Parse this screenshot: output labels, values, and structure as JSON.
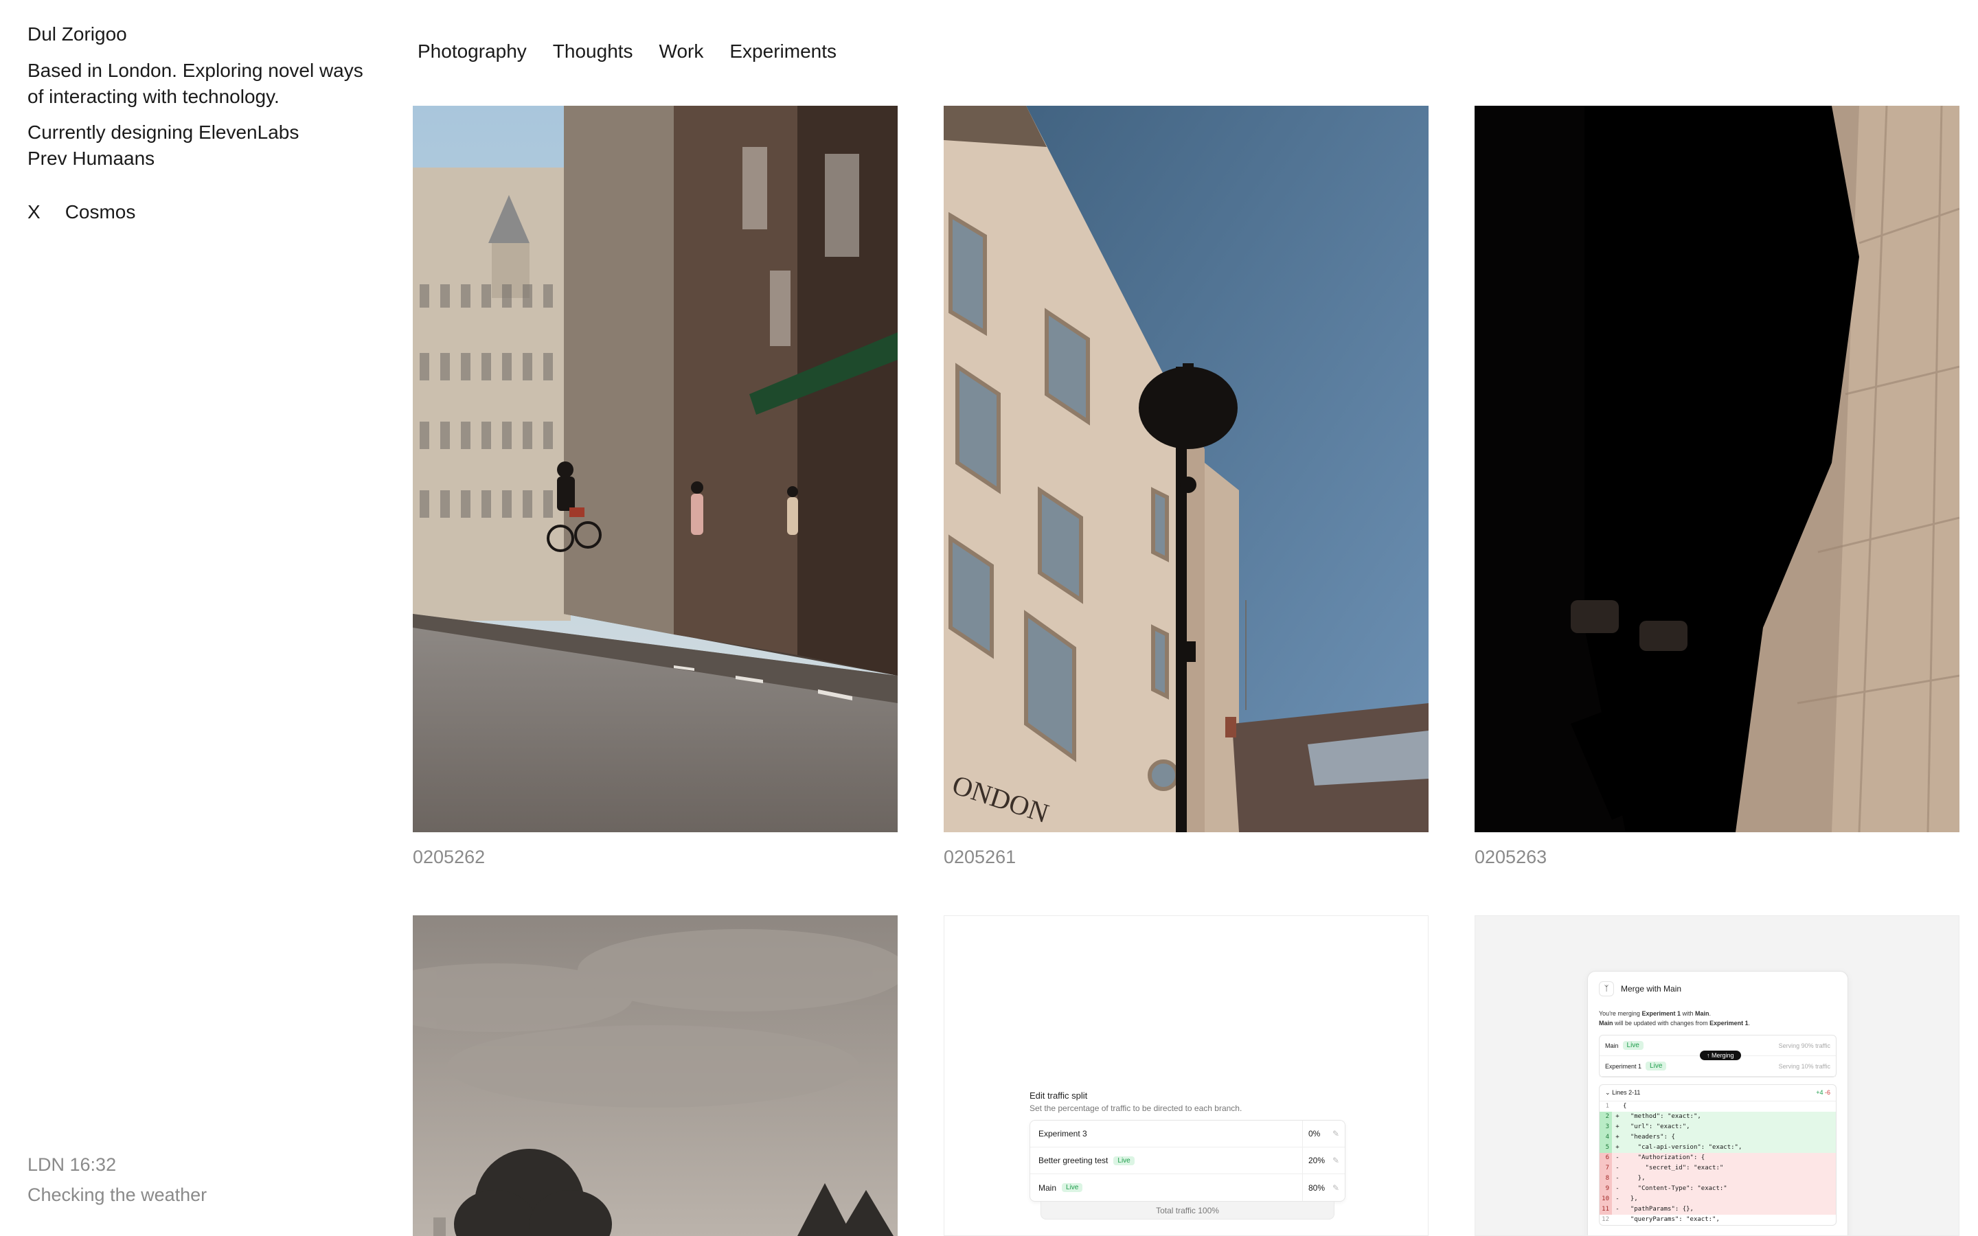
{
  "profile": {
    "name": "Dul Zorigoo",
    "about_line1": "Based in London. Exploring novel ways",
    "about_line2": "of interacting with technology.",
    "current": "Currently designing ElevenLabs",
    "prev": "Prev Humaans",
    "links": [
      "X",
      "Cosmos"
    ]
  },
  "footer": {
    "time": "LDN 16:32",
    "status": "Checking the weather"
  },
  "nav": [
    "Photography",
    "Thoughts",
    "Work",
    "Experiments"
  ],
  "gallery": [
    {
      "caption": "0205262",
      "image": "street-cyclist-photo"
    },
    {
      "caption": "0205261",
      "image": "building-streetlamp-photo"
    },
    {
      "caption": "0205263",
      "image": "shadow-walker-photo"
    },
    {
      "caption": "",
      "image": "trees-sky-photo"
    },
    {
      "caption": "",
      "image": "traffic-split-ui"
    },
    {
      "caption": "",
      "image": "merge-ui"
    }
  ],
  "traffic_split": {
    "title": "Edit traffic split",
    "subtitle": "Set the percentage of traffic to be directed to each branch.",
    "rows": [
      {
        "label": "Experiment 3",
        "badge": "",
        "pct": "0%"
      },
      {
        "label": "Better greeting test",
        "badge": "Live",
        "pct": "20%"
      },
      {
        "label": "Main",
        "badge": "Live",
        "pct": "80%"
      }
    ],
    "total": "Total traffic 100%"
  },
  "merge": {
    "title": "Merge with Main",
    "desc_line1_a": "You're merging ",
    "desc_line1_b": "Experiment 1",
    "desc_line1_c": " with ",
    "desc_line1_d": "Main",
    "desc_line2_a": "Main",
    "desc_line2_b": " will be updated with changes from ",
    "desc_line2_c": "Experiment 1",
    "branches": [
      {
        "name": "Main",
        "badge": "Live",
        "traffic": "Serving 90% traffic"
      },
      {
        "name": "Experiment 1",
        "badge": "Live",
        "traffic": "Serving 10% traffic"
      }
    ],
    "merging_label": "Merging",
    "diff_header": "Lines 2-11",
    "diff_add": "+4",
    "diff_del": "-6",
    "lines": [
      {
        "n": "1",
        "s": "",
        "c": "{",
        "t": "ctx"
      },
      {
        "n": "2",
        "s": "+",
        "c": "  \"method\": \"exact:\",",
        "t": "add"
      },
      {
        "n": "3",
        "s": "+",
        "c": "  \"url\": \"exact:\",",
        "t": "add"
      },
      {
        "n": "4",
        "s": "+",
        "c": "  \"headers\": {",
        "t": "add"
      },
      {
        "n": "5",
        "s": "+",
        "c": "    \"cal-api-version\": \"exact:\",",
        "t": "add"
      },
      {
        "n": "6",
        "s": "-",
        "c": "    \"Authorization\": {",
        "t": "del"
      },
      {
        "n": "7",
        "s": "-",
        "c": "      \"secret_id\": \"exact:\"",
        "t": "del"
      },
      {
        "n": "8",
        "s": "-",
        "c": "    },",
        "t": "del"
      },
      {
        "n": "9",
        "s": "-",
        "c": "    \"Content-Type\": \"exact:\"",
        "t": "del"
      },
      {
        "n": "10",
        "s": "-",
        "c": "  },",
        "t": "del"
      },
      {
        "n": "11",
        "s": "-",
        "c": "  \"pathParams\": {},",
        "t": "del"
      },
      {
        "n": "12",
        "s": "",
        "c": "  \"queryParams\": \"exact:\",",
        "t": "ctx"
      }
    ]
  }
}
